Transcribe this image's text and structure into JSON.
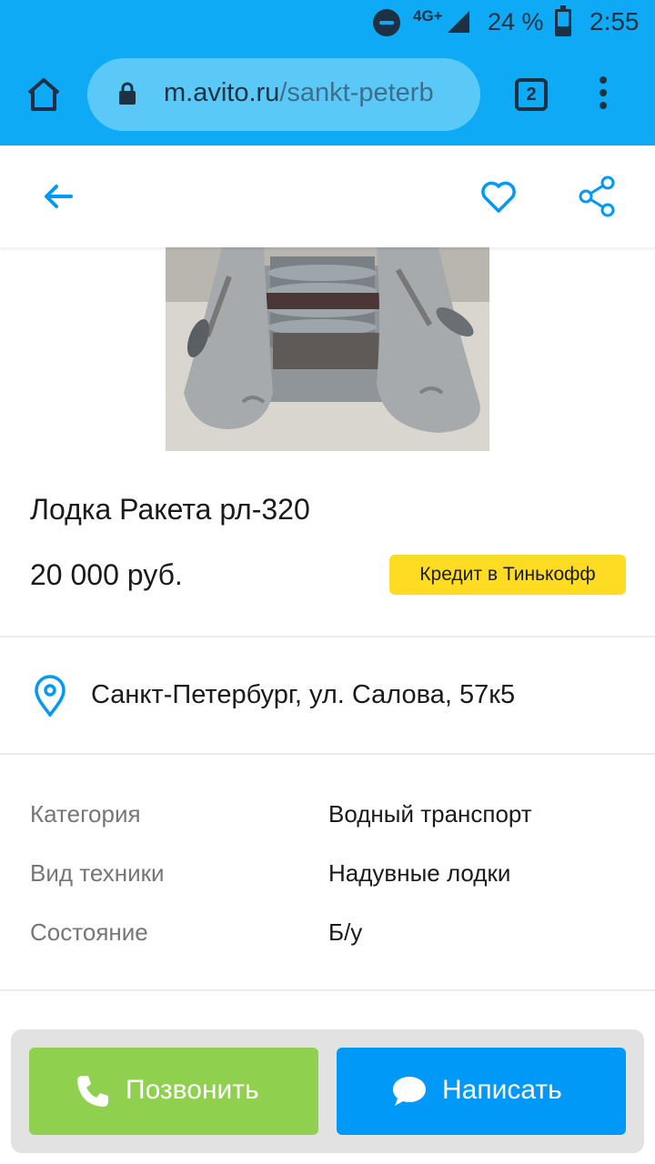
{
  "status_bar": {
    "network": "4G+",
    "battery": "24 %",
    "time": "2:55"
  },
  "browser": {
    "url_domain": "m.avito.ru",
    "url_rest": "/sankt-peterb",
    "tab_count": "2",
    "icons": [
      "home-icon",
      "lock-icon",
      "tabs-icon",
      "more-vert-icon"
    ]
  },
  "header": {
    "icons": [
      "arrow-back-icon",
      "heart-icon",
      "share-icon"
    ]
  },
  "listing": {
    "title": "Лодка Ракета рл-320",
    "price": "20 000 руб.",
    "credit_label": "Кредит в Тинькофф",
    "address": "Санкт-Петербург, ул. Салова, 57к5"
  },
  "params": [
    {
      "label": "Категория",
      "value": "Водный транспорт"
    },
    {
      "label": "Вид техники",
      "value": "Надувные лодки"
    },
    {
      "label": "Состояние",
      "value": "Б/у"
    }
  ],
  "actions": {
    "call_label": "Позвонить",
    "message_label": "Написать"
  },
  "colors": {
    "chrome": "#0eaaf5",
    "accent": "#0099f7",
    "call_button": "#8fd14f",
    "credit_badge": "#ffdc24"
  }
}
